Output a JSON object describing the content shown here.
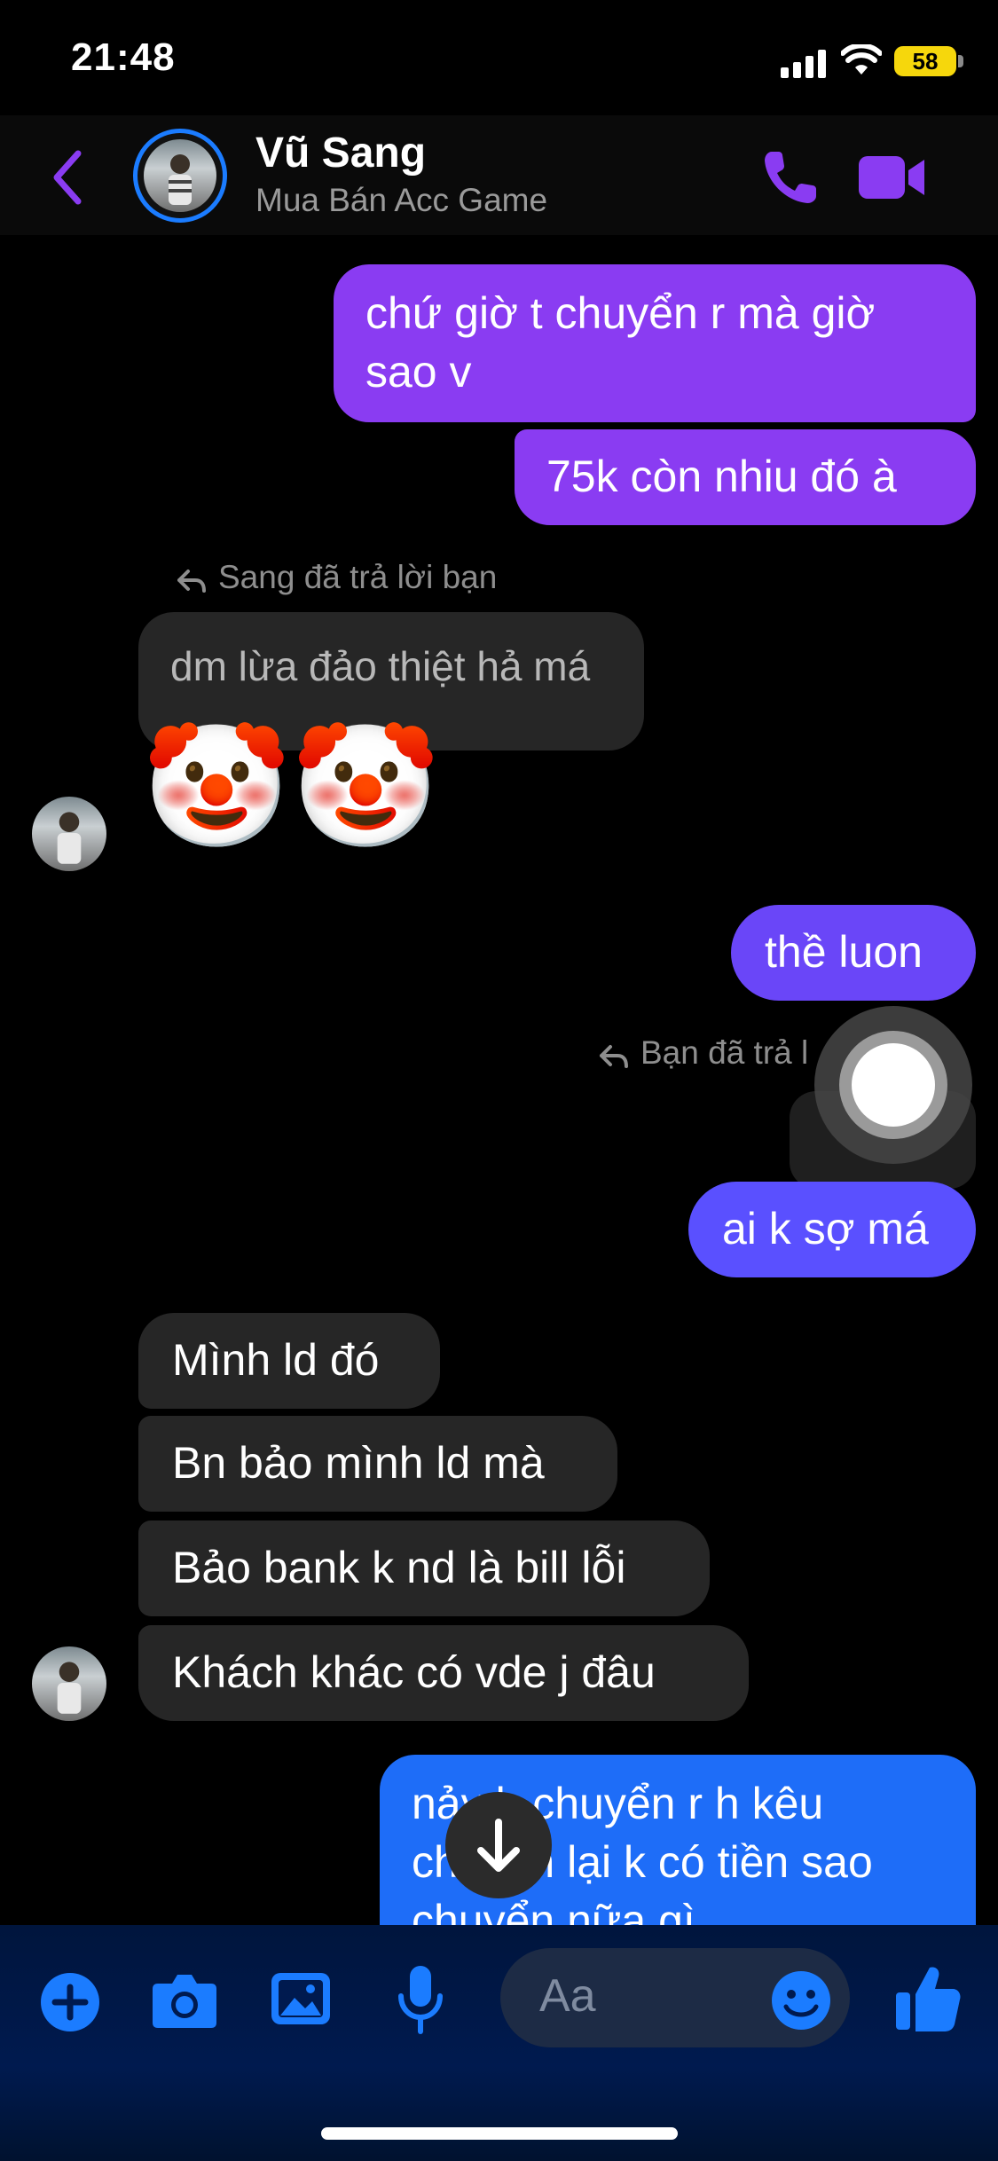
{
  "status_bar": {
    "time": "21:48",
    "battery": "58"
  },
  "header": {
    "name": "Vũ Sang",
    "subtitle": "Mua Bán Acc Game",
    "back_icon": "chevron-left-icon",
    "call_icon": "phone-icon",
    "video_icon": "video-camera-icon",
    "accent": "#8a3cf2"
  },
  "messages": {
    "m1": "chứ giờ t chuyển r mà giờ sao v",
    "m2": "75k còn nhiu đó à",
    "reply1_label": "Sang đã trả lời bạn",
    "quoted1": "dm lừa đảo thiệt hả má",
    "emoji1": "🤡",
    "emoji2": "🤡",
    "m3": "thề luon",
    "reply2_label": "Bạn đã trả l",
    "m4": "ai k sợ má",
    "m5": "Mình ld đó",
    "m6": "Bn bảo mình ld mà",
    "m7": "Bảo bank k nd là bill lỗi",
    "m8": "Khách khác có vde j đâu",
    "m9": "nảy h chuyển r h kêu chuyển lại k có tiền sao chuyển nữa gì"
  },
  "composer": {
    "placeholder": "Aa",
    "icons": [
      "plus-circle-icon",
      "camera-icon",
      "image-icon",
      "microphone-icon",
      "emoji-icon",
      "thumbs-up-icon"
    ]
  },
  "colors": {
    "outgoing_purple": "#8a3cf2",
    "outgoing_blue": "#5a50ff",
    "incoming": "#262626",
    "brand_blue": "#1b7cff"
  }
}
